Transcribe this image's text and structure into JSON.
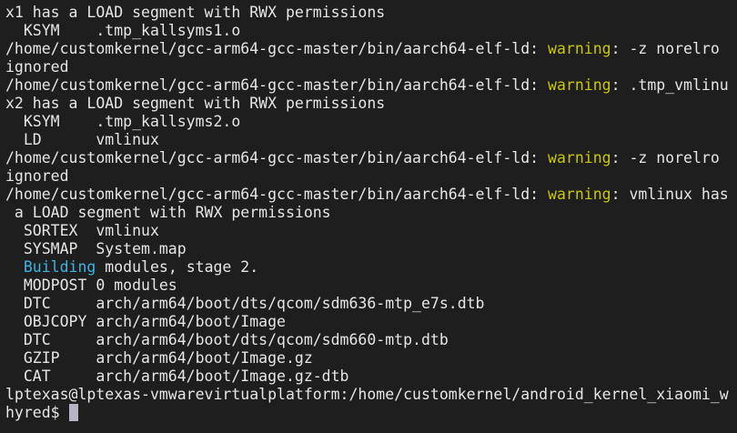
{
  "colors": {
    "background": "#1e1e1e",
    "text": "#e6e6e6",
    "warning": "#c8c800",
    "info": "#3bb4e6",
    "cursor": "#b4b4c4"
  },
  "terminal": {
    "lines": [
      [
        {
          "t": "x1 has a LOAD segment with RWX permissions"
        }
      ],
      [
        {
          "t": "  KSYM    .tmp_kallsyms1.o"
        }
      ],
      [
        {
          "t": "/home/customkernel/gcc-arm64-gcc-master/bin/aarch64-elf-ld: "
        },
        {
          "t": "warning",
          "c": "warn"
        },
        {
          "t": ": -z norelro"
        }
      ],
      [
        {
          "t": "ignored"
        }
      ],
      [
        {
          "t": "/home/customkernel/gcc-arm64-gcc-master/bin/aarch64-elf-ld: "
        },
        {
          "t": "warning",
          "c": "warn"
        },
        {
          "t": ": .tmp_vmlinu"
        }
      ],
      [
        {
          "t": "x2 has a LOAD segment with RWX permissions"
        }
      ],
      [
        {
          "t": "  KSYM    .tmp_kallsyms2.o"
        }
      ],
      [
        {
          "t": "  LD      vmlinux"
        }
      ],
      [
        {
          "t": "/home/customkernel/gcc-arm64-gcc-master/bin/aarch64-elf-ld: "
        },
        {
          "t": "warning",
          "c": "warn"
        },
        {
          "t": ": -z norelro"
        }
      ],
      [
        {
          "t": "ignored"
        }
      ],
      [
        {
          "t": "/home/customkernel/gcc-arm64-gcc-master/bin/aarch64-elf-ld: "
        },
        {
          "t": "warning",
          "c": "warn"
        },
        {
          "t": ": vmlinux has"
        }
      ],
      [
        {
          "t": " a LOAD segment with RWX permissions"
        }
      ],
      [
        {
          "t": "  SORTEX  vmlinux"
        }
      ],
      [
        {
          "t": "  SYSMAP  System.map"
        }
      ],
      [
        {
          "t": "  "
        },
        {
          "t": "Building",
          "c": "info"
        },
        {
          "t": " modules, stage 2."
        }
      ],
      [
        {
          "t": "  MODPOST 0 modules"
        }
      ],
      [
        {
          "t": "  DTC     arch/arm64/boot/dts/qcom/sdm636-mtp_e7s.dtb"
        }
      ],
      [
        {
          "t": "  OBJCOPY arch/arm64/boot/Image"
        }
      ],
      [
        {
          "t": "  DTC     arch/arm64/boot/dts/qcom/sdm660-mtp.dtb"
        }
      ],
      [
        {
          "t": "  GZIP    arch/arm64/boot/Image.gz"
        }
      ],
      [
        {
          "t": "  CAT     arch/arm64/boot/Image.gz-dtb"
        }
      ],
      [
        {
          "t": "lptexas@lptexas-vmwarevirtualplatform:/home/customkernel/android_kernel_xiaomi_w"
        }
      ],
      [
        {
          "t": "hyred$ "
        }
      ]
    ]
  }
}
